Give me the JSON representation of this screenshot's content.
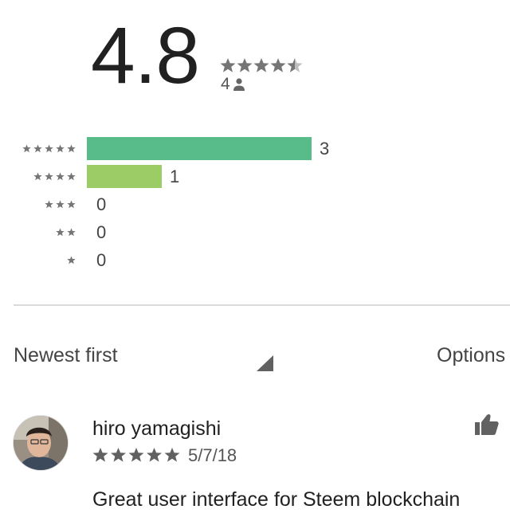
{
  "rating_summary": {
    "average": "4.8",
    "average_value": 4.8,
    "rater_count": "4",
    "star_color": "#757575"
  },
  "histogram": [
    {
      "stars": 5,
      "count": "3",
      "fraction_of_max": 1.0,
      "bar_color": "#57bb8a"
    },
    {
      "stars": 4,
      "count": "1",
      "fraction_of_max": 0.333,
      "bar_color": "#9ccc65"
    },
    {
      "stars": 3,
      "count": "0",
      "fraction_of_max": 0,
      "bar_color": "#ffcf02"
    },
    {
      "stars": 2,
      "count": "0",
      "fraction_of_max": 0,
      "bar_color": "#ffb235"
    },
    {
      "stars": 1,
      "count": "0",
      "fraction_of_max": 0,
      "bar_color": "#ff8c5a"
    }
  ],
  "sort": {
    "label": "Newest first",
    "options_label": "Options"
  },
  "review": {
    "author": "hiro yamagishi",
    "stars": 5,
    "date": "5/7/18",
    "text": "Great user interface for Steem blockchain"
  }
}
